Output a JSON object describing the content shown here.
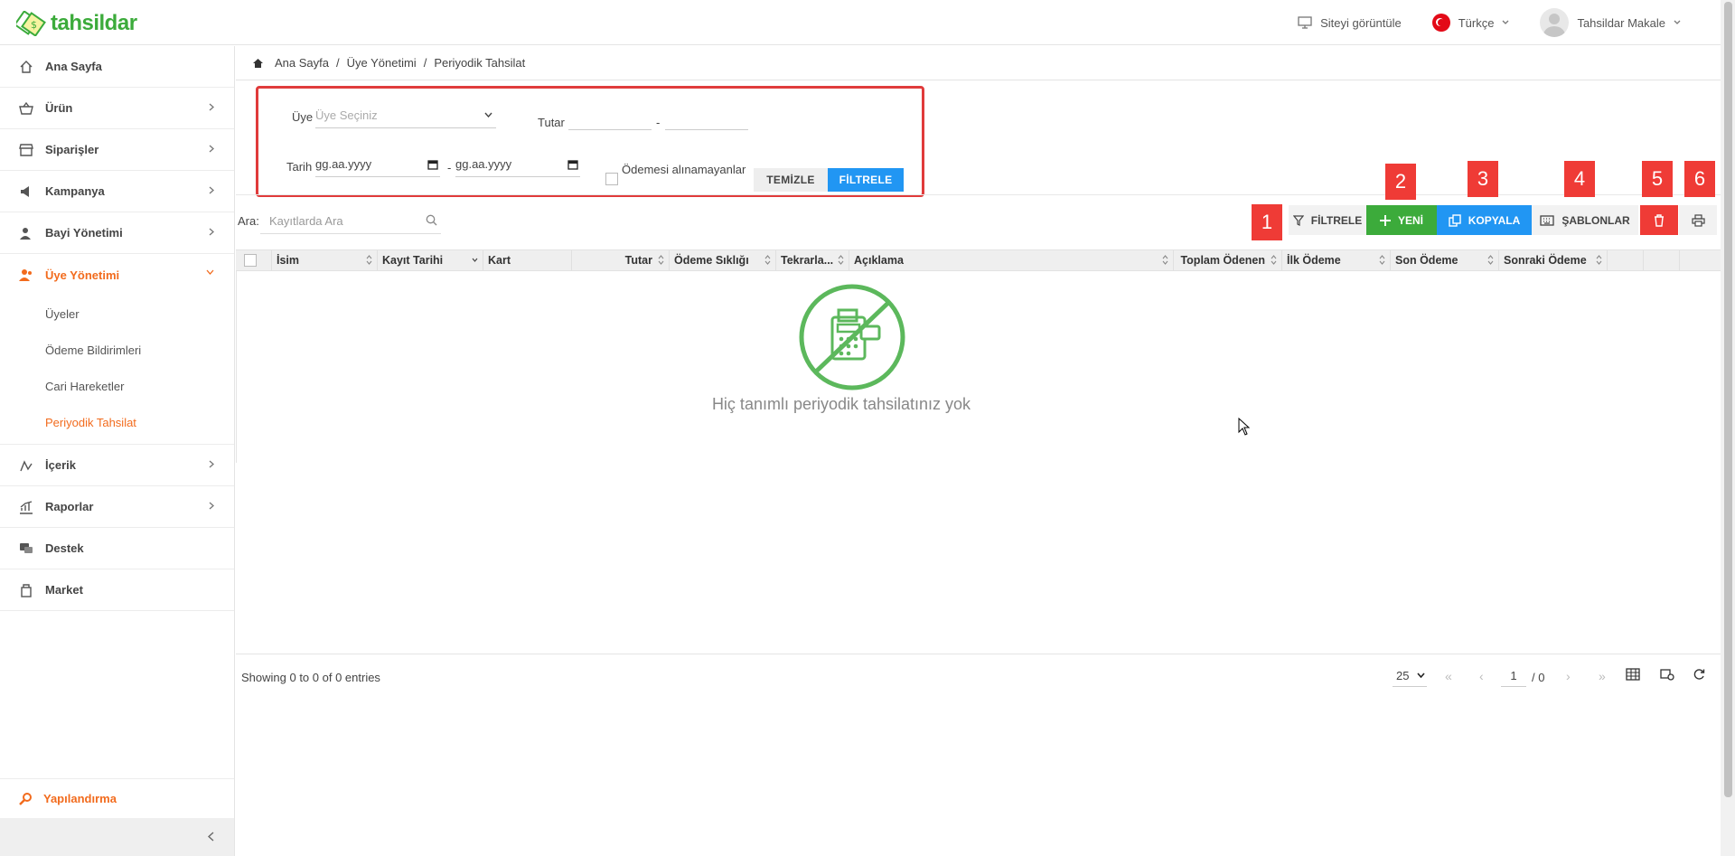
{
  "app": {
    "logo_text": "tahsildar",
    "accent": "#f26b1d",
    "brand_green": "#3cab3b"
  },
  "topbar": {
    "view_site": "Siteyi görüntüle",
    "language": "Türkçe",
    "user_name": "Tahsildar Makale"
  },
  "sidebar": {
    "items": [
      {
        "label": "Ana Sayfa",
        "icon": "home-icon"
      },
      {
        "label": "Ürün",
        "icon": "basket-icon"
      },
      {
        "label": "Siparişler",
        "icon": "store-icon"
      },
      {
        "label": "Kampanya",
        "icon": "megaphone-icon"
      },
      {
        "label": "Bayi Yönetimi",
        "icon": "dealer-icon"
      },
      {
        "label": "Üye Yönetimi",
        "icon": "users-icon"
      },
      {
        "label": "İçerik",
        "icon": "content-icon"
      },
      {
        "label": "Raporlar",
        "icon": "chart-icon"
      },
      {
        "label": "Destek",
        "icon": "support-icon"
      },
      {
        "label": "Market",
        "icon": "market-icon"
      }
    ],
    "sub_items": [
      "Üyeler",
      "Ödeme Bildirimleri",
      "Cari Hareketler",
      "Periyodik Tahsilat"
    ],
    "config_label": "Yapılandırma"
  },
  "breadcrumb": [
    "Ana Sayfa",
    "Üye Yönetimi",
    "Periyodik Tahsilat"
  ],
  "filter": {
    "member_label": "Üye",
    "member_placeholder": "Üye Seçiniz",
    "amount_label": "Tutar",
    "dash": "-",
    "date_label": "Tarih",
    "date_start": "gg.aa.yyyy",
    "date_end": "gg.aa.yyyy",
    "unpaid_label": "Ödemesi alınamayanlar",
    "clear_button": "TEMİZLE",
    "filter_button": "FİLTRELE"
  },
  "toolbar": {
    "search_label": "Ara:",
    "search_placeholder": "Kayıtlarda Ara",
    "filter": "FİLTRELE",
    "new": "YENİ",
    "copy": "KOPYALA",
    "templates": "ŞABLONLAR",
    "badges": [
      "1",
      "2",
      "3",
      "4",
      "5",
      "6"
    ]
  },
  "table": {
    "columns": [
      "İsim",
      "Kayıt Tarihi",
      "Kart",
      "Tutar",
      "Ödeme Sıklığı",
      "Tekrarla...",
      "Açıklama",
      "Toplam Ödenen",
      "İlk Ödeme",
      "Son Ödeme",
      "Sonraki Ödeme"
    ],
    "empty_message": "Hiç tanımlı periyodik tahsilatınız yok"
  },
  "footer": {
    "info": "Showing 0 to 0 of 0 entries",
    "page_size": "25",
    "current_page": "1",
    "total_pages": "/ 0"
  }
}
